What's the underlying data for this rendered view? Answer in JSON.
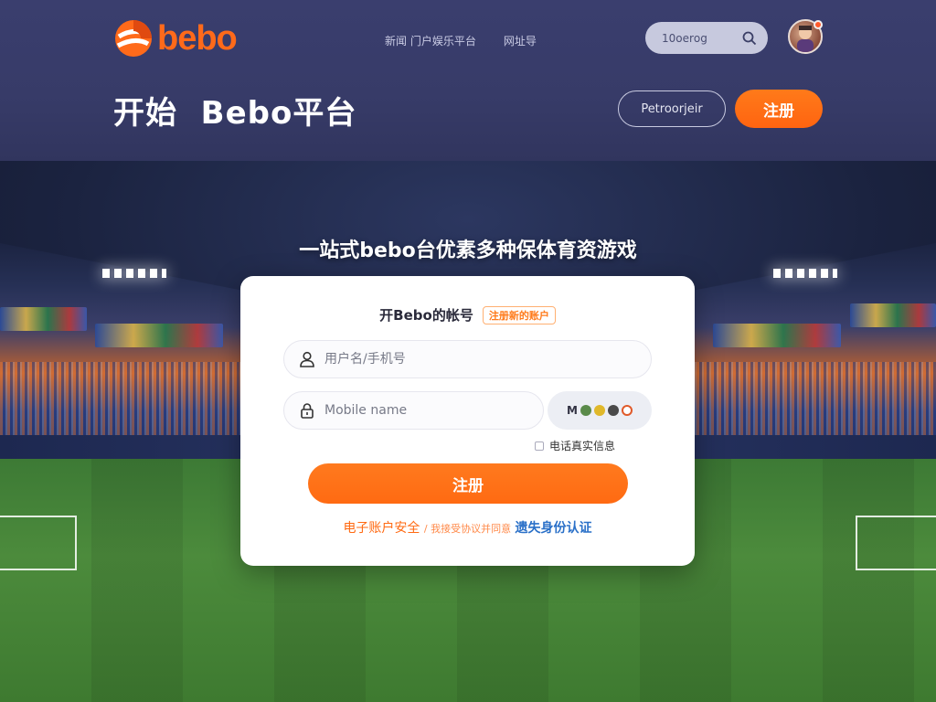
{
  "brand": {
    "logo_text": "bebo",
    "accent": "#ff6a1a"
  },
  "nav": {
    "items": [
      "新闻 门户娱乐平台",
      "网址导"
    ]
  },
  "search": {
    "placeholder": "10ᴏerᴏg"
  },
  "hero": {
    "title": "开始  Bebo平台",
    "outline_label": "Petroorjeir",
    "register_label": "注册"
  },
  "tagline": "一站式bebo台优素多种保体育资游戏",
  "card": {
    "title": "开Bebo的帐号",
    "badge": "注册新的账户",
    "username_placeholder": "用户名/手机号",
    "password_placeholder": "Mobile name",
    "captcha_text": "M",
    "remember_label": "电话真实信息",
    "submit_label": "注册",
    "link_left": "电子账户安全",
    "link_sep": "/ 我接受协议并同意",
    "link_right": "遗失身份认证"
  }
}
